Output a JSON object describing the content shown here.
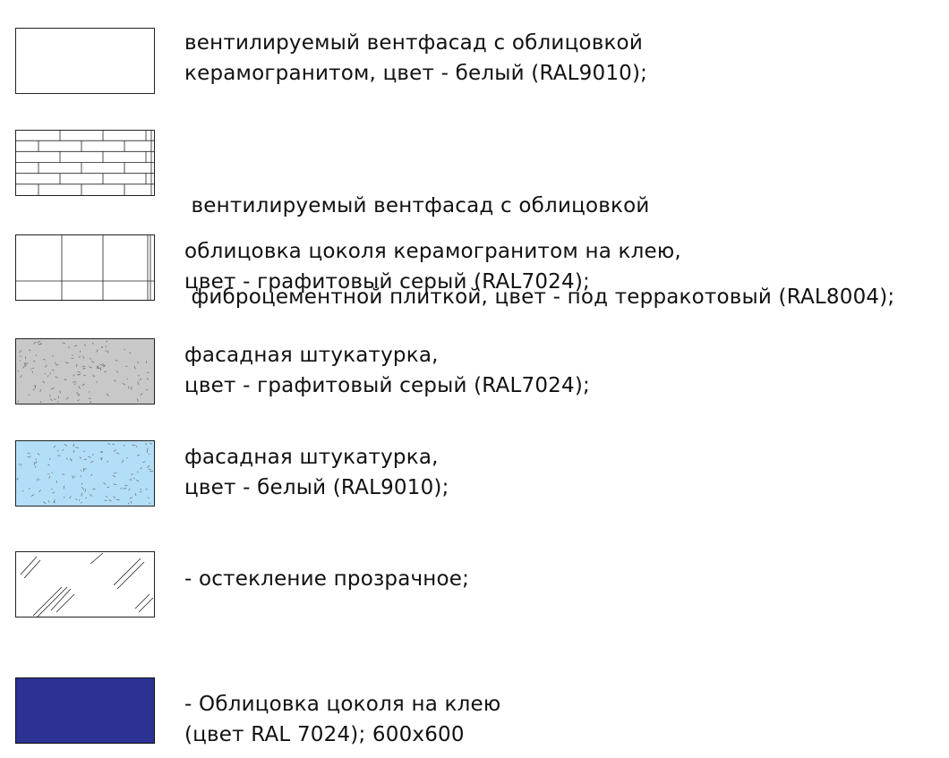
{
  "legend": [
    {
      "key": "ceramic-granite-white",
      "pattern": "plain",
      "fill": "#ffffff",
      "lines": [
        "вентилируемый вентфасад с облицовкой",
        "керамогранитом, цвет - белый (RAL9010);"
      ]
    },
    {
      "key": "fibercement-terracotta",
      "pattern": "brick",
      "fill": "#ffffff",
      "lines": [
        " вентилируемый вентфасад с облицовкой",
        " фиброцементной плиткой, цвет - под терракотовый (RAL8004);"
      ]
    },
    {
      "key": "plinth-ceramic-graphite",
      "pattern": "tiles",
      "fill": "#ffffff",
      "lines": [
        "облицовка цоколя керамогранитом на клею,",
        "цвет - графитовый серый (RAL7024);"
      ]
    },
    {
      "key": "plaster-graphite",
      "pattern": "speckle",
      "fill": "#c8c8c8",
      "lines": [
        "фасадная штукатурка,",
        "цвет - графитовый серый (RAL7024);"
      ]
    },
    {
      "key": "plaster-white",
      "pattern": "speckle",
      "fill": "#b3def7",
      "lines": [
        "фасадная штукатурка,",
        "цвет - белый (RAL9010);"
      ]
    },
    {
      "key": "glazing",
      "pattern": "glass",
      "fill": "#ffffff",
      "lines": [
        "- остекление прозрачное;"
      ]
    },
    {
      "key": "plinth-blue",
      "pattern": "solid",
      "fill": "#2c3192",
      "lines": [
        "- Облицовка цоколя на клею",
        "(цвет RAL 7024); 600x600"
      ]
    }
  ],
  "colors": {
    "stroke": "#222222",
    "speckle": "#6a6a6a"
  }
}
